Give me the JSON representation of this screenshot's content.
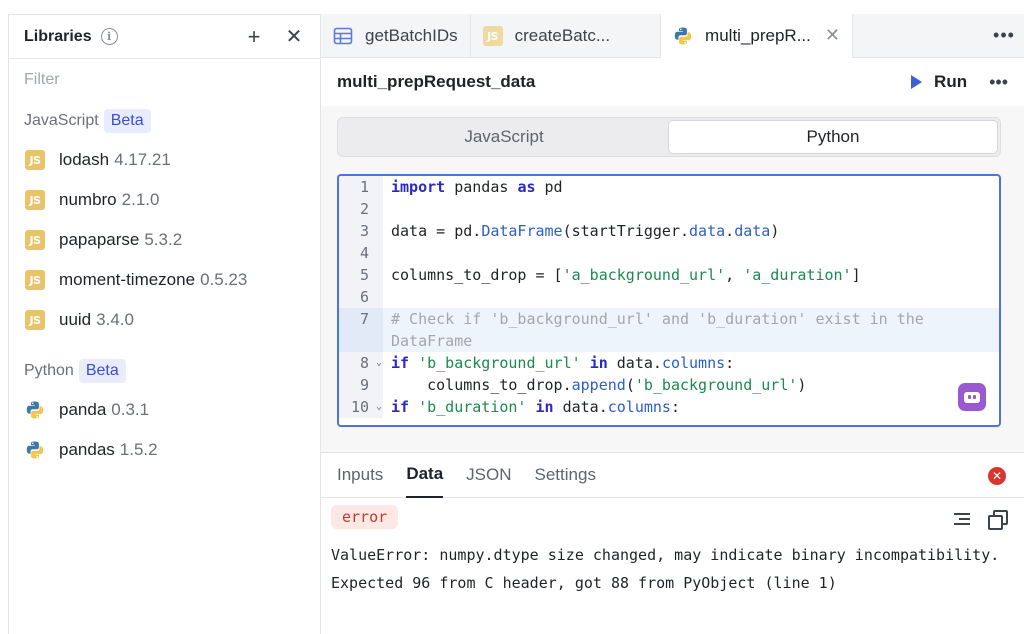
{
  "libraries": {
    "title": "Libraries",
    "filter_placeholder": "Filter",
    "sections": [
      {
        "label": "JavaScript",
        "badge": "Beta",
        "items": [
          {
            "name": "lodash",
            "version": "4.17.21"
          },
          {
            "name": "numbro",
            "version": "2.1.0"
          },
          {
            "name": "papaparse",
            "version": "5.3.2"
          },
          {
            "name": "moment-timezone",
            "version": "0.5.23"
          },
          {
            "name": "uuid",
            "version": "3.4.0"
          }
        ]
      },
      {
        "label": "Python",
        "badge": "Beta",
        "items": [
          {
            "name": "panda",
            "version": "0.3.1"
          },
          {
            "name": "pandas",
            "version": "1.5.2"
          }
        ]
      }
    ],
    "js_badge_text": "JS"
  },
  "tabs": [
    {
      "label": "getBatchIDs",
      "icon": "table-icon"
    },
    {
      "label": "createBatc...",
      "icon": "js-icon"
    },
    {
      "label": "multi_prepR...",
      "icon": "python-icon",
      "active": true
    }
  ],
  "query": {
    "title": "multi_prepRequest_data",
    "run_label": "Run"
  },
  "language_toggle": [
    "JavaScript",
    "Python"
  ],
  "editor": {
    "line_numbers": [
      "1",
      "2",
      "3",
      "4",
      "5",
      "6",
      "7",
      "8",
      "9",
      "10"
    ]
  },
  "result": {
    "tabs": [
      "Inputs",
      "Data",
      "JSON",
      "Settings"
    ],
    "active_tab": "Data",
    "badge": "error",
    "message": "ValueError: numpy.dtype size changed, may indicate binary incompatibility. Expected 96 from C header, got 88 from PyObject (line 1)"
  },
  "colors": {
    "accent": "#3a5fd9",
    "error": "#d9372b",
    "beta_bg": "#e8ecfb",
    "js_badge": "#e8c56b",
    "copilot": "#9b59d0"
  }
}
